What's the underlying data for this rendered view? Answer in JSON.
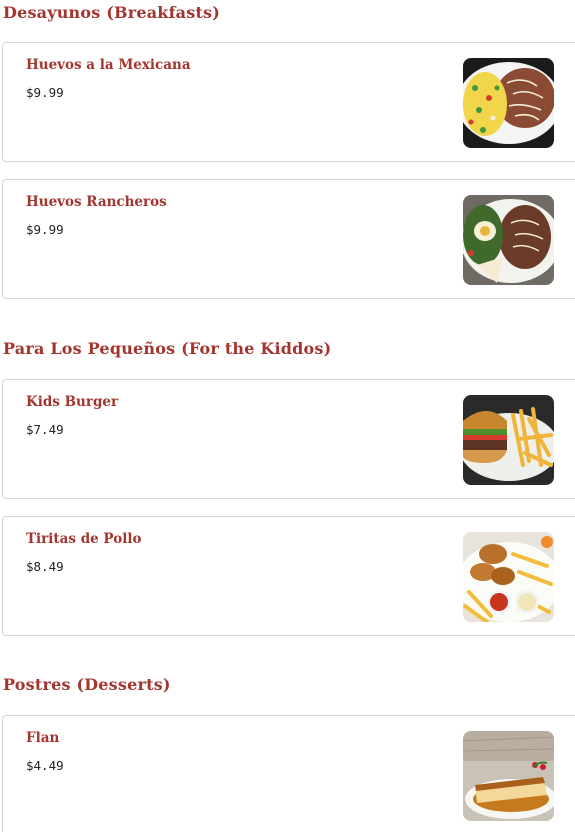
{
  "sections": [
    {
      "title": "Desayunos (Breakfasts)",
      "items": [
        {
          "name": "Huevos a la Mexicana",
          "price": "$9.99",
          "image": "huevos-mexicana-photo"
        },
        {
          "name": "Huevos Rancheros",
          "price": "$9.99",
          "image": "huevos-rancheros-photo"
        }
      ]
    },
    {
      "title": "Para Los Pequeños (For the Kiddos)",
      "items": [
        {
          "name": "Kids Burger",
          "price": "$7.49",
          "image": "kids-burger-photo"
        },
        {
          "name": "Tiritas de Pollo",
          "price": "$8.49",
          "image": "tiritas-pollo-photo"
        }
      ]
    },
    {
      "title": "Postres (Desserts)",
      "items": [
        {
          "name": "Flan",
          "price": "$4.49",
          "image": "flan-photo"
        }
      ]
    }
  ],
  "colors": {
    "accent": "#a3342e",
    "card_border": "#d4d4d4",
    "price_text": "#222222"
  }
}
